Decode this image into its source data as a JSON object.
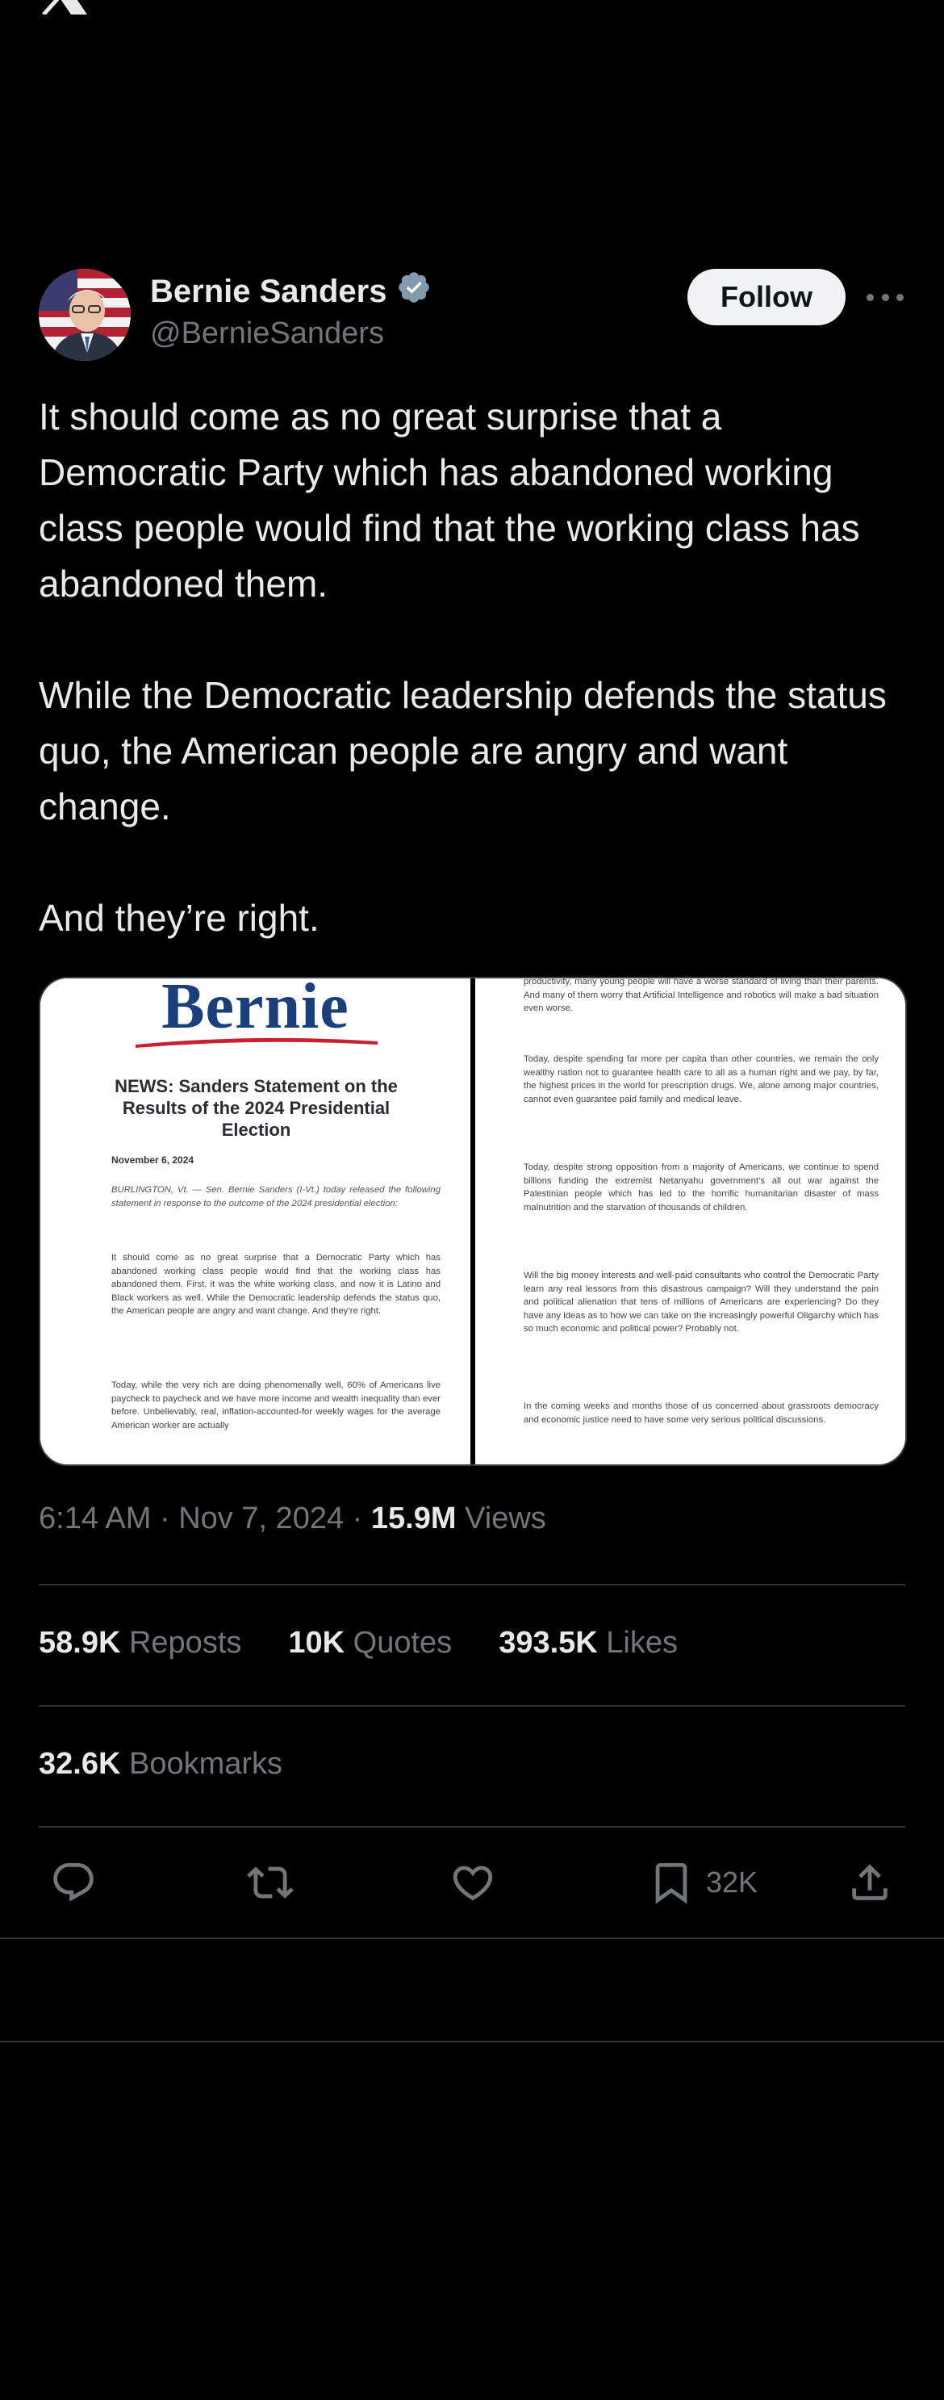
{
  "header": {
    "logo_icon": "x-logo-icon"
  },
  "author": {
    "name": "Bernie Sanders",
    "handle": "@BernieSanders",
    "verified_icon": "verified-badge-icon",
    "verified_color": "#829aab"
  },
  "actions_top": {
    "follow_label": "Follow",
    "more_icon": "more-icon"
  },
  "tweet": {
    "paragraphs": [
      "It should come as no great surprise that a Democratic Party which has abandoned working class people would find that the working class has abandoned them.",
      "While the Democratic leadership defends the status quo, the American people are angry and want change.",
      "And they’re right."
    ]
  },
  "media": {
    "left_page": {
      "logo_text": "Bernie",
      "headline": "NEWS: Sanders Statement on the Results of the 2024 Presidential Election",
      "date": "November 6, 2024",
      "intro": "BURLINGTON, Vt. — Sen. Bernie Sanders (I-Vt.) today released the following statement in response to the outcome of the 2024 presidential election:",
      "para1": "It should come as no great surprise that a Democratic Party which has abandoned working class people would find that the working class has abandoned them. First, it was the white working class, and now it is Latino and Black workers as well. While the Democratic leadership defends the status quo, the American people are angry and want change. And they’re right.",
      "para2": "Today, while the very rich are doing phenomenally well, 60% of Americans live paycheck to paycheck and we have more income and wealth inequality than ever before. Unbelievably, real, inflation-accounted-for weekly wages for the average American worker are actually"
    },
    "right_page": {
      "para0": "productivity, many young people will have a worse standard of living than their parents. And many of them worry that Artificial Intelligence and robotics will make a bad situation even worse.",
      "para1": "Today, despite spending far more per capita than other countries, we remain the only wealthy nation not to guarantee health care to all as a human right and we pay, by far, the highest prices in the world for prescription drugs. We, alone among major countries, cannot even guarantee paid family and medical leave.",
      "para2": "Today, despite strong opposition from a majority of Americans, we continue to spend billions funding the extremist Netanyahu government’s all out war against the Palestinian people which has led to the horrific humanitarian disaster of mass malnutrition and the starvation of thousands of children.",
      "para3": "Will the big money interests and well-paid consultants who control the Democratic Party learn any real lessons from this disastrous campaign? Will they understand the pain and political alienation that tens of millions of Americans are experiencing? Do they have any ideas as to how we can take on the increasingly powerful Oligarchy which has so much economic and political power? Probably not.",
      "para4": "In the coming weeks and months those of us concerned about grassroots democracy and economic justice need to have some very serious political discussions."
    }
  },
  "meta": {
    "time": "6:14 AM",
    "sep1": " · ",
    "date": "Nov 7, 2024",
    "sep2": " · ",
    "views_count": "15.9M",
    "views_label": "Views"
  },
  "stats": {
    "reposts_count": "58.9K",
    "reposts_label": "Reposts",
    "quotes_count": "10K",
    "quotes_label": "Quotes",
    "likes_count": "393.5K",
    "likes_label": "Likes",
    "bookmarks_count": "32.6K",
    "bookmarks_label": "Bookmarks"
  },
  "action_bar": {
    "reply_icon": "reply-icon",
    "repost_icon": "repost-icon",
    "like_icon": "heart-icon",
    "bookmark_icon": "bookmark-icon",
    "bookmark_count": "32K",
    "share_icon": "share-icon"
  }
}
